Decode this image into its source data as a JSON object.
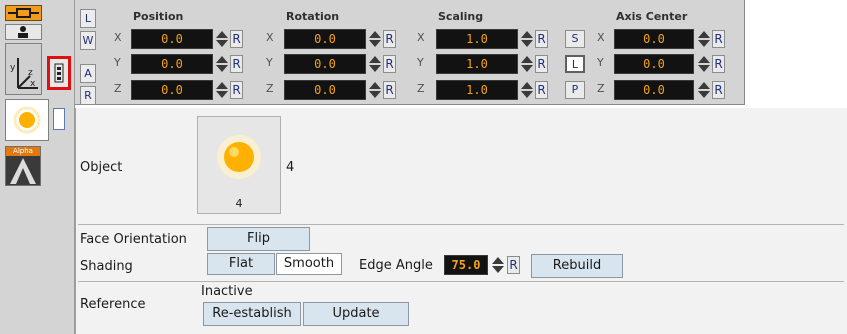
{
  "transform": {
    "mode_buttons": [
      "L",
      "W",
      "A",
      "R"
    ],
    "groups": [
      {
        "title": "Position",
        "axes": [
          {
            "axis": "X",
            "value": "0.0"
          },
          {
            "axis": "Y",
            "value": "0.0"
          },
          {
            "axis": "Z",
            "value": "0.0"
          }
        ]
      },
      {
        "title": "Rotation",
        "axes": [
          {
            "axis": "X",
            "value": "0.0"
          },
          {
            "axis": "Y",
            "value": "0.0"
          },
          {
            "axis": "Z",
            "value": "0.0"
          }
        ]
      },
      {
        "title": "Scaling",
        "axes": [
          {
            "axis": "X",
            "value": "1.0"
          },
          {
            "axis": "Y",
            "value": "1.0"
          },
          {
            "axis": "Z",
            "value": "1.0"
          }
        ]
      },
      {
        "title": "Axis Center",
        "axes": [
          {
            "axis": "X",
            "value": "0.0"
          },
          {
            "axis": "Y",
            "value": "0.0"
          },
          {
            "axis": "Z",
            "value": "0.0"
          }
        ]
      }
    ],
    "reset_label": "R",
    "scale_buttons": [
      "S",
      "L",
      "P"
    ]
  },
  "left_tools": {
    "alpha_label": "Alpha"
  },
  "editor": {
    "object_label": "Object",
    "object_count": "4",
    "object_thumb_number": "4",
    "face_orientation_label": "Face Orientation",
    "flip_label": "Flip",
    "shading_label": "Shading",
    "flat_label": "Flat",
    "smooth_label": "Smooth",
    "edge_angle_label": "Edge Angle",
    "edge_angle_value": "75.0",
    "edge_reset_label": "R",
    "rebuild_label": "Rebuild",
    "reference_label": "Reference",
    "reference_status": "Inactive",
    "reestablish_label": "Re-establish",
    "update_label": "Update"
  },
  "colors": {
    "accent_orange": "#f29b1a",
    "value_text": "#f4a21c",
    "highlight_red": "#e01010"
  }
}
